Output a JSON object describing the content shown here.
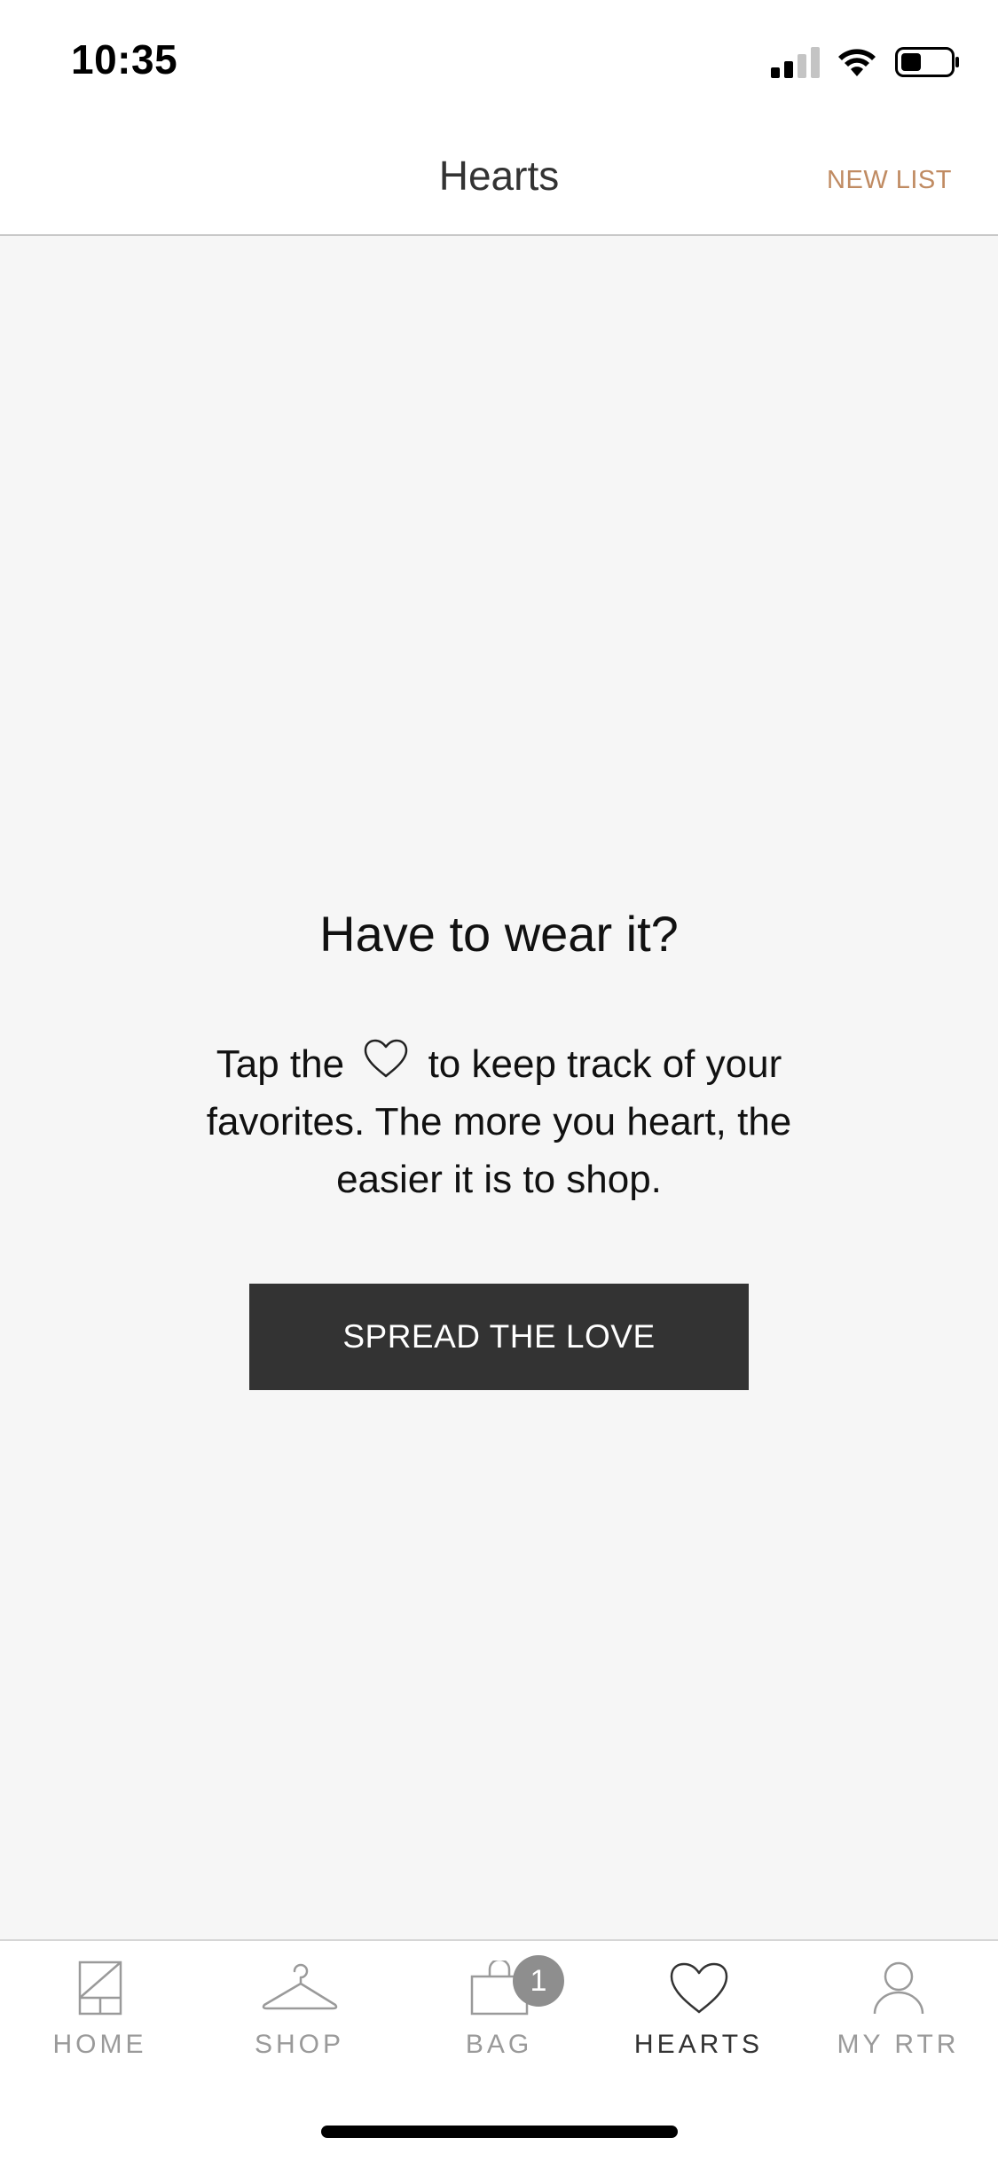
{
  "status_bar": {
    "time": "10:35"
  },
  "header": {
    "title": "Hearts",
    "action_label": "NEW LIST"
  },
  "empty_state": {
    "title": "Have to wear it?",
    "body_before_icon": "Tap the",
    "body_after_icon": "to keep track of your favorites. The more you heart, the easier it is to shop.",
    "button_label": "SPREAD THE LOVE"
  },
  "tab_bar": {
    "tabs": [
      {
        "label": "HOME",
        "icon": "home-icon"
      },
      {
        "label": "SHOP",
        "icon": "hanger-icon"
      },
      {
        "label": "BAG",
        "icon": "bag-icon",
        "badge": "1"
      },
      {
        "label": "HEARTS",
        "icon": "heart-icon",
        "active": true
      },
      {
        "label": "MY RTR",
        "icon": "person-icon"
      }
    ]
  },
  "colors": {
    "accent": "#c08b62",
    "button_bg": "#333333",
    "page_bg": "#f6f6f6",
    "inactive_tab": "#9a9a9a"
  }
}
